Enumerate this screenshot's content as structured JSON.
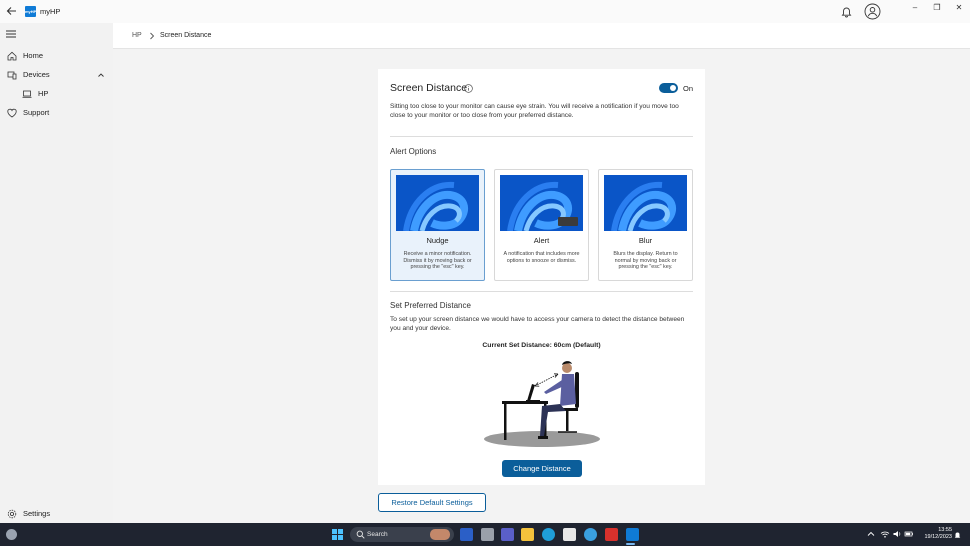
{
  "app": {
    "title": "myHP",
    "logo_text": "myHP"
  },
  "window": {
    "minimize": "–",
    "restore": "❐",
    "close": "✕"
  },
  "sidebar": {
    "items": [
      {
        "label": "Home",
        "icon": "home-icon"
      },
      {
        "label": "Devices",
        "icon": "devices-icon"
      },
      {
        "label": "HP",
        "icon": "laptop-icon"
      },
      {
        "label": "Support",
        "icon": "support-icon"
      }
    ],
    "settings_label": "Settings"
  },
  "breadcrumb": {
    "root": "HP",
    "current": "Screen Distance"
  },
  "screen_distance": {
    "title": "Screen Distance",
    "toggle_state": "On",
    "description": "Sitting too close to your monitor can cause eye strain. You will receive a notification if you move too close to your monitor or too close from your preferred distance.",
    "alert_options_title": "Alert Options",
    "options": [
      {
        "name": "Nudge",
        "description": "Receive a minor notification. Dismiss it by moving back or pressing the \"esc\" key.",
        "selected": true
      },
      {
        "name": "Alert",
        "description": "A notification that includes more options to snooze or dismiss.",
        "selected": false
      },
      {
        "name": "Blur",
        "description": "Blurs the display. Return to normal by moving back or pressing the \"esc\" key.",
        "selected": false
      }
    ],
    "preferred_title": "Set Preferred Distance",
    "preferred_description": "To set up your screen distance we would have to access your camera to detect the distance between you and your device.",
    "current_distance": "Current Set Distance: 60cm (Default)",
    "change_button": "Change Distance"
  },
  "restore_button": "Restore Default Settings",
  "taskbar": {
    "search_placeholder": "Search",
    "time": "13:55",
    "date": "19/12/2023"
  },
  "colors": {
    "accent": "#0b5e9a",
    "selected_bg": "#e9f2fb",
    "taskbar": "#1f2430"
  }
}
